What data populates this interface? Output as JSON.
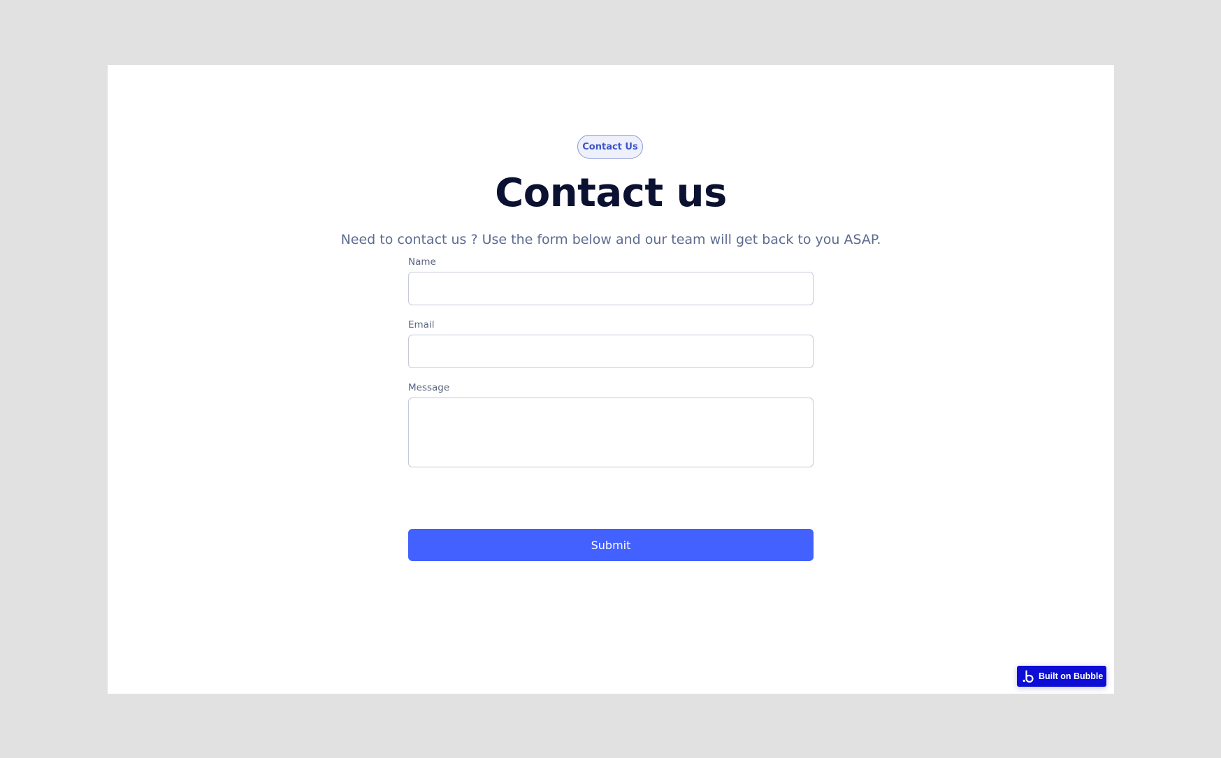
{
  "tag": "Contact Us",
  "title": "Contact us",
  "subtitle": "Need to contact us ? Use the form below and our team will get back to you ASAP.",
  "form": {
    "name_label": "Name",
    "name_value": "",
    "email_label": "Email",
    "email_value": "",
    "message_label": "Message",
    "message_value": "",
    "submit_label": "Submit"
  },
  "badge": {
    "label": "Built on Bubble",
    "icon": "bubble-logo-icon"
  },
  "colors": {
    "page_background": "#e1e1e1",
    "card_background": "#ffffff",
    "accent": "#4261ff",
    "badge": "#0d0dd6",
    "title": "#0b1130",
    "subtitle": "#5d6b8f"
  }
}
